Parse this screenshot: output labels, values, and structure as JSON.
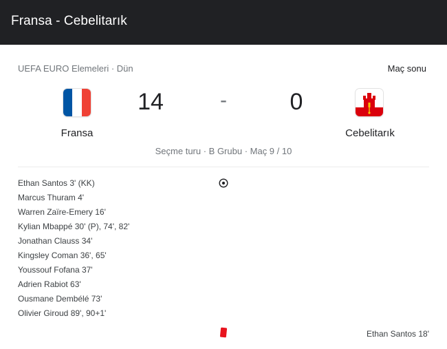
{
  "header": {
    "title": "Fransa - Cebelitarık"
  },
  "match": {
    "competition": "UEFA EURO Elemeleri · Dün",
    "status": "Maç sonu",
    "round": "Seçme turu · B Grubu · Maç 9 / 10",
    "score_separator": "-",
    "home": {
      "name": "Fransa",
      "score": "14",
      "flag_colors": [
        "#0055a4",
        "#ffffff",
        "#ef4135"
      ]
    },
    "away": {
      "name": "Cebelitarık",
      "score": "0",
      "flag_colors": [
        "#ffffff",
        "#da000c",
        "#f6c700"
      ]
    }
  },
  "home_events": [
    "Ethan Santos 3' (KK)",
    "Marcus Thuram 4'",
    "Warren Zaïre-Emery 16'",
    "Kylian Mbappé 30' (P), 74', 82'",
    "Jonathan Clauss 34'",
    "Kingsley Coman 36', 65'",
    "Youssouf Fofana 37'",
    "Adrien Rabiot 63'",
    "Ousmane Dembélé 73'",
    "Olivier Giroud 89', 90+1'"
  ],
  "away_events": [
    "Ethan Santos 18'"
  ],
  "icons": {
    "goal": "soccer-ball-icon",
    "card": "red-card-icon"
  },
  "colors": {
    "header_bg": "#202124",
    "red_card": "#e8141e"
  }
}
